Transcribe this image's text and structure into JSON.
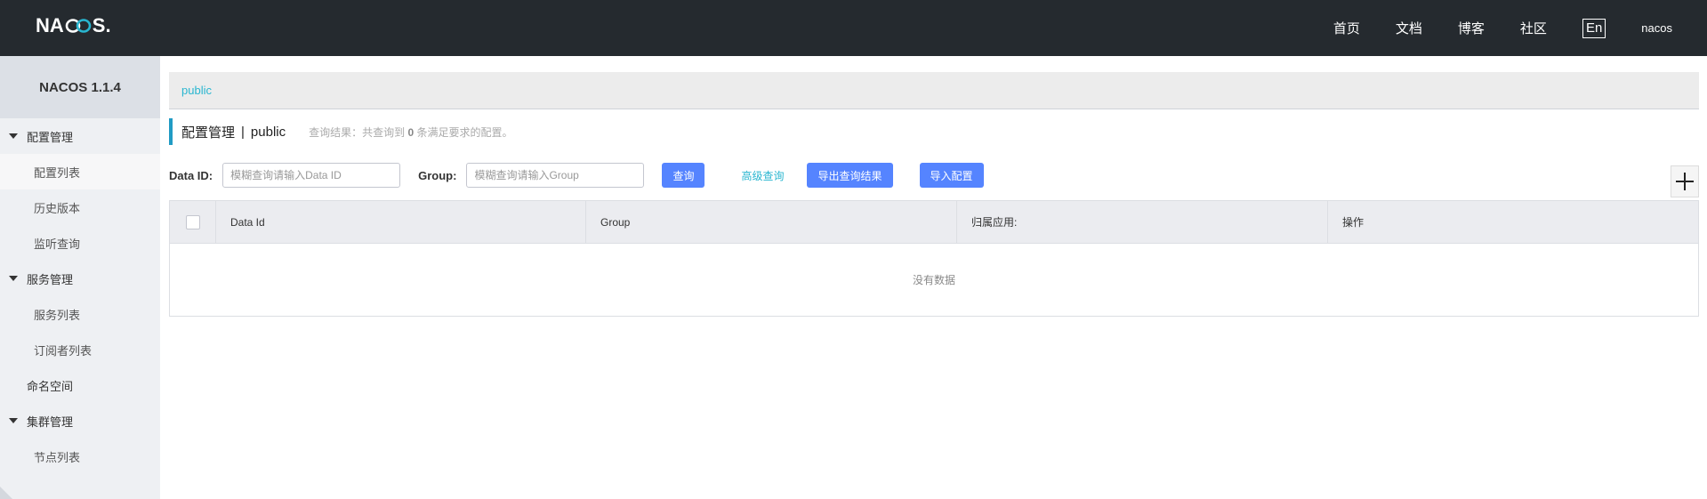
{
  "header": {
    "logo_text_left": "NA",
    "logo_text_right": "S",
    "logo_dot": ".",
    "nav": [
      "首页",
      "文档",
      "博客",
      "社区"
    ],
    "lang": "En",
    "user": "nacos",
    "logo_color": "#29b6d0"
  },
  "sidebar": {
    "title": "NACOS 1.1.4",
    "groups": [
      {
        "label": "配置管理",
        "items": [
          "配置列表",
          "历史版本",
          "监听查询"
        ]
      },
      {
        "label": "服务管理",
        "items": [
          "服务列表",
          "订阅者列表"
        ]
      }
    ],
    "namespace": "命名空间",
    "cluster": {
      "label": "集群管理",
      "items": [
        "节点列表"
      ]
    }
  },
  "main": {
    "namespace_tab": "public",
    "title": "配置管理",
    "title_sep": "|",
    "title_ns": "public",
    "result_prefix": "查询结果：共查询到",
    "result_count": "0",
    "result_suffix": "条满足要求的配置。",
    "filters": {
      "data_id_label": "Data ID:",
      "data_id_placeholder": "模糊查询请输入Data ID",
      "group_label": "Group:",
      "group_placeholder": "模糊查询请输入Group",
      "query_btn": "查询",
      "advanced_link": "高级查询",
      "export_btn": "导出查询结果",
      "import_btn": "导入配置"
    },
    "table": {
      "columns": [
        "Data Id",
        "Group",
        "归属应用:",
        "操作"
      ],
      "empty_text": "没有数据"
    }
  },
  "colors": {
    "header_bg": "#252a2f",
    "accent": "#29b6d0",
    "primary_button": "#5584ff"
  }
}
